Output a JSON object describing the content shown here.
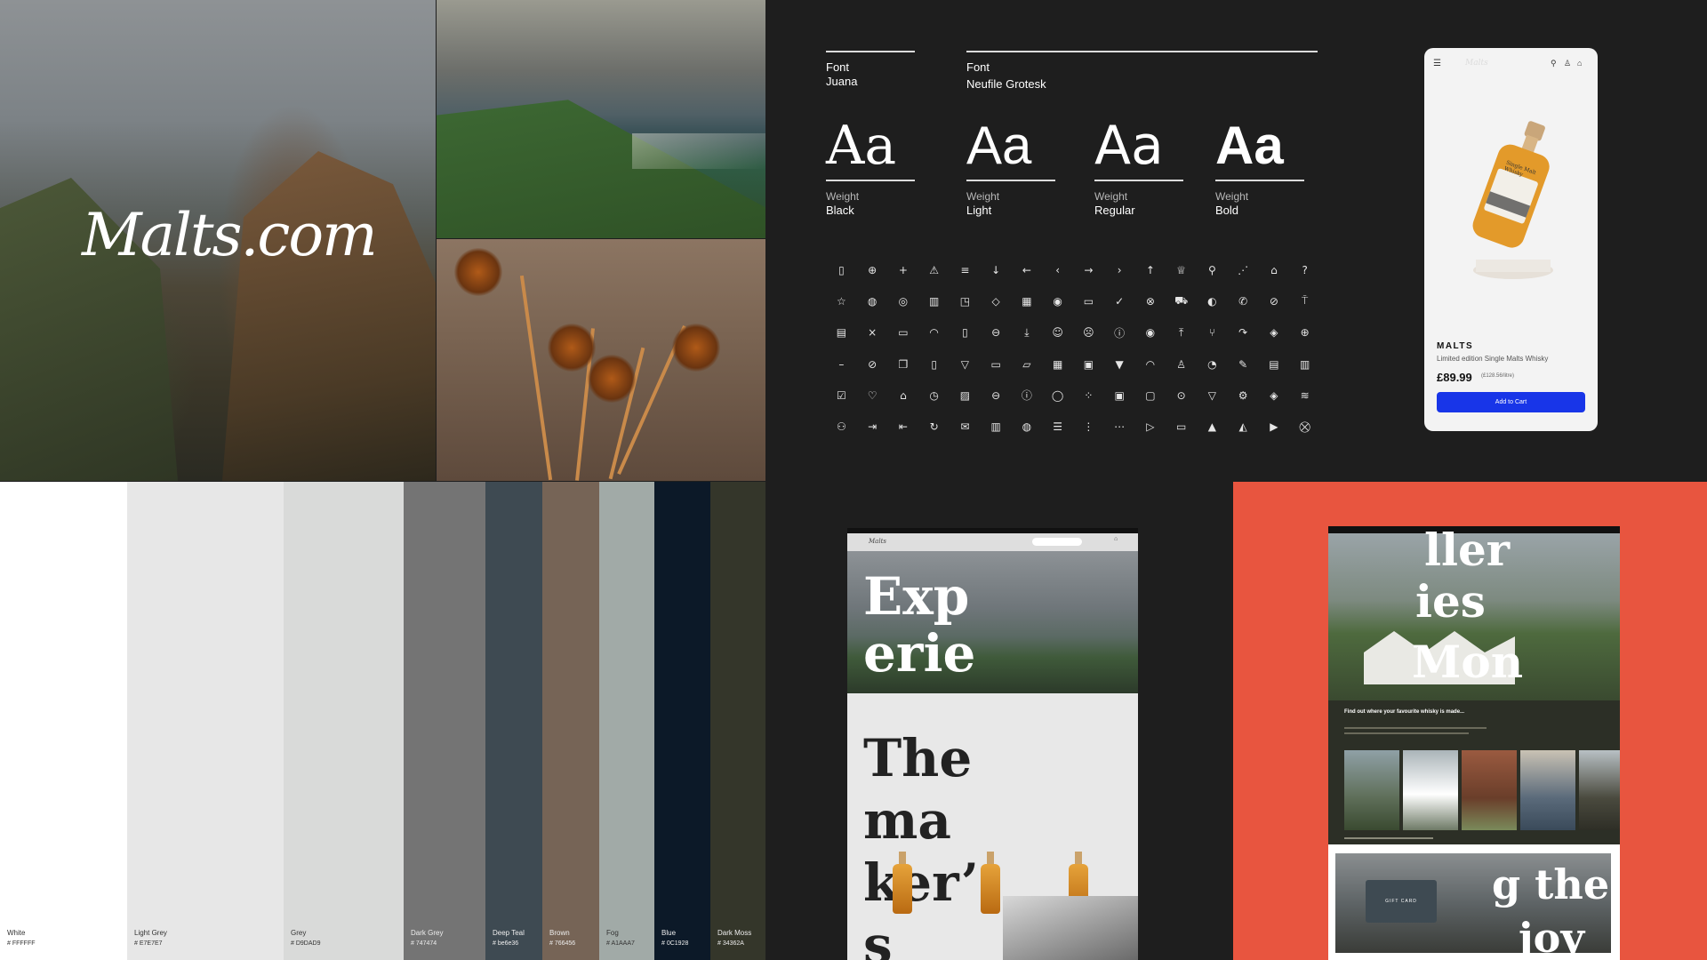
{
  "brand": {
    "logo_text": "Malts.com"
  },
  "fonts": {
    "primary": {
      "label": "Font",
      "name": "Juana"
    },
    "secondary": {
      "label": "Font",
      "name": "Neufile Grotesk"
    },
    "specimen_glyph": "Aa",
    "weights": [
      {
        "label": "Weight",
        "value": "Black"
      },
      {
        "label": "Weight",
        "value": "Light"
      },
      {
        "label": "Weight",
        "value": "Regular"
      },
      {
        "label": "Weight",
        "value": "Bold"
      }
    ]
  },
  "icons": [
    "phone-icon",
    "plus-circle-icon",
    "plus-icon",
    "warning-icon",
    "list-icon",
    "arrow-down-icon",
    "arrow-left-icon",
    "chevron-left-icon",
    "arrow-right-icon",
    "chevron-right-icon",
    "arrow-up-icon",
    "trophy-icon",
    "search-icon",
    "share-icon",
    "bag-icon",
    "help-icon",
    "star-icon",
    "badge-icon",
    "award-icon",
    "book-icon",
    "bookmark-icon",
    "box-icon",
    "calendar-icon",
    "camera-icon",
    "chat-icon",
    "check-icon",
    "close-circle-icon",
    "truck-icon",
    "palette-icon",
    "call-icon",
    "block-icon",
    "pin-icon",
    "store-icon",
    "close-icon",
    "monitor-icon",
    "headset-icon",
    "trash-icon",
    "zoom-out-icon",
    "download-icon",
    "smile-icon",
    "frown-icon",
    "info-icon",
    "eye-icon",
    "upload-icon",
    "dining-icon",
    "forward-icon",
    "shield-icon",
    "zoom-in-icon",
    "minus-icon",
    "eye-off-icon",
    "copy-icon",
    "tablet-icon",
    "filter-icon",
    "folder-icon",
    "folder-open-icon",
    "grid-icon",
    "gift-icon",
    "cocktail-icon",
    "headphones-icon",
    "user-icon",
    "bell-icon",
    "pencil-icon",
    "print-icon",
    "basket-icon",
    "checkbox-icon",
    "heart-icon",
    "home-icon",
    "clock-icon",
    "image-icon",
    "minus-circle-icon",
    "info-circle-icon",
    "bulb-icon",
    "loader-icon",
    "lock-icon",
    "unlock-icon",
    "verified-icon",
    "thumbs-down-icon",
    "settings-icon",
    "shield-check-icon",
    "wifi-icon",
    "group-icon",
    "sign-in-icon",
    "sign-out-icon",
    "refresh-icon",
    "mail-icon",
    "map-icon",
    "location-icon",
    "menu-icon",
    "more-vertical-icon",
    "more-horizontal-icon",
    "play-square-icon",
    "wallet-icon",
    "thumbs-up-icon",
    "rocket-icon",
    "play-icon",
    "cart-icon"
  ],
  "icon_glyphs": [
    "▯",
    "⊕",
    "+",
    "⚠",
    "≡",
    "↓",
    "←",
    "‹",
    "→",
    "›",
    "↑",
    "♕",
    "⚲",
    "⋰",
    "⌂",
    "?",
    "☆",
    "◍",
    "◎",
    "▥",
    "◳",
    "◇",
    "▦",
    "◉",
    "▭",
    "✓",
    "⊗",
    "⛟",
    "◐",
    "✆",
    "⊘",
    "⍑",
    "▤",
    "×",
    "▭",
    "◠",
    "▯",
    "⊖",
    "⤓",
    "☺",
    "☹",
    "ⓘ",
    "◉",
    "⤒",
    "⑂",
    "↷",
    "◈",
    "⊕",
    "–",
    "⊘",
    "❐",
    "▯",
    "▽",
    "▭",
    "▱",
    "▦",
    "▣",
    "▼",
    "◠",
    "♙",
    "◔",
    "✎",
    "▤",
    "▥",
    "☑",
    "♡",
    "⌂",
    "◷",
    "▨",
    "⊖",
    "ⓘ",
    "◯",
    "⁘",
    "▣",
    "▢",
    "⊙",
    "▽",
    "⚙",
    "◈",
    "≋",
    "⚇",
    "⇥",
    "⇤",
    "↻",
    "✉",
    "▥",
    "◍",
    "☰",
    "⋮",
    "⋯",
    "▷",
    "▭",
    "▲",
    "◭",
    "▶",
    "⛒"
  ],
  "phone": {
    "logo": "Malts",
    "product_brand": "MALTS",
    "product_desc": "Limited edition Single Malts Whisky",
    "price": "£89.99",
    "unit_price": "(£128.56/litre)",
    "cta": "Add to Cart",
    "bottle_label": "Single Malt Whisky"
  },
  "palette": [
    {
      "name": "White",
      "hex": "# FFFFFF",
      "color": "#FFFFFF",
      "text": "#333333"
    },
    {
      "name": "Light Grey",
      "hex": "# E7E7E7",
      "color": "#E7E7E7",
      "text": "#333333"
    },
    {
      "name": "Grey",
      "hex": "# D9DAD9",
      "color": "#D9DAD9",
      "text": "#333333"
    },
    {
      "name": "Dark Grey",
      "hex": "# 747474",
      "color": "#747474",
      "text": "#eeeeee"
    },
    {
      "name": "Deep Teal",
      "hex": "# be6e36",
      "color": "#3E4A52",
      "text": "#eeeeee"
    },
    {
      "name": "Brown",
      "hex": "# 766456",
      "color": "#766456",
      "text": "#eeeeee"
    },
    {
      "name": "Fog",
      "hex": "# A1AAA7",
      "color": "#A1AAA7",
      "text": "#333333"
    },
    {
      "name": "Blue",
      "hex": "# 0C1928",
      "color": "#0C1928",
      "text": "#eeeeee"
    },
    {
      "name": "Dark Moss",
      "hex": "# 34362A",
      "color": "#34362A",
      "text": "#eeeeee"
    }
  ],
  "web_left": {
    "logo": "Malts",
    "hero_line1": "Exp",
    "hero_line2": "erie",
    "title_line1": "The",
    "title_line2": "ma",
    "title_line3": "ker’",
    "title_line4": "s"
  },
  "web_right": {
    "hero_line1": "ller",
    "hero_line2": "ies",
    "hero_line3": "Mon",
    "heading": "Find out where your favourite whisky is made...",
    "gift_card": "GIFT CARD",
    "gift_line1": "g the",
    "gift_line2": "joy"
  }
}
